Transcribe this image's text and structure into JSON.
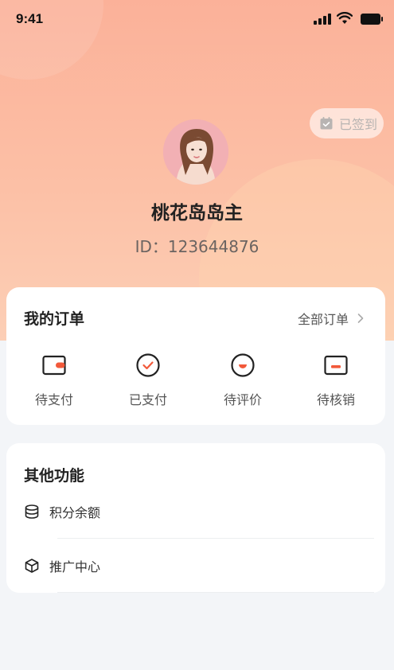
{
  "status_bar": {
    "time": "9:41"
  },
  "profile": {
    "checkin_label": "已签到",
    "nickname": "桃花岛岛主",
    "id_text": "ID：123644876"
  },
  "orders": {
    "title": "我的订单",
    "all_label": "全部订单",
    "items": [
      {
        "label": "待支付",
        "icon": "wallet-icon"
      },
      {
        "label": "已支付",
        "icon": "check-circle-icon"
      },
      {
        "label": "待评价",
        "icon": "comment-circle-icon"
      },
      {
        "label": "待核销",
        "icon": "ticket-icon"
      }
    ]
  },
  "other": {
    "title": "其他功能",
    "items": [
      {
        "label": "积分余额",
        "icon": "coins-stack-icon"
      },
      {
        "label": "推广中心",
        "icon": "cube-icon"
      }
    ]
  },
  "colors": {
    "accent": "#f2593a",
    "hero_top": "#fbb199",
    "hero_bottom": "#fccfb6"
  }
}
